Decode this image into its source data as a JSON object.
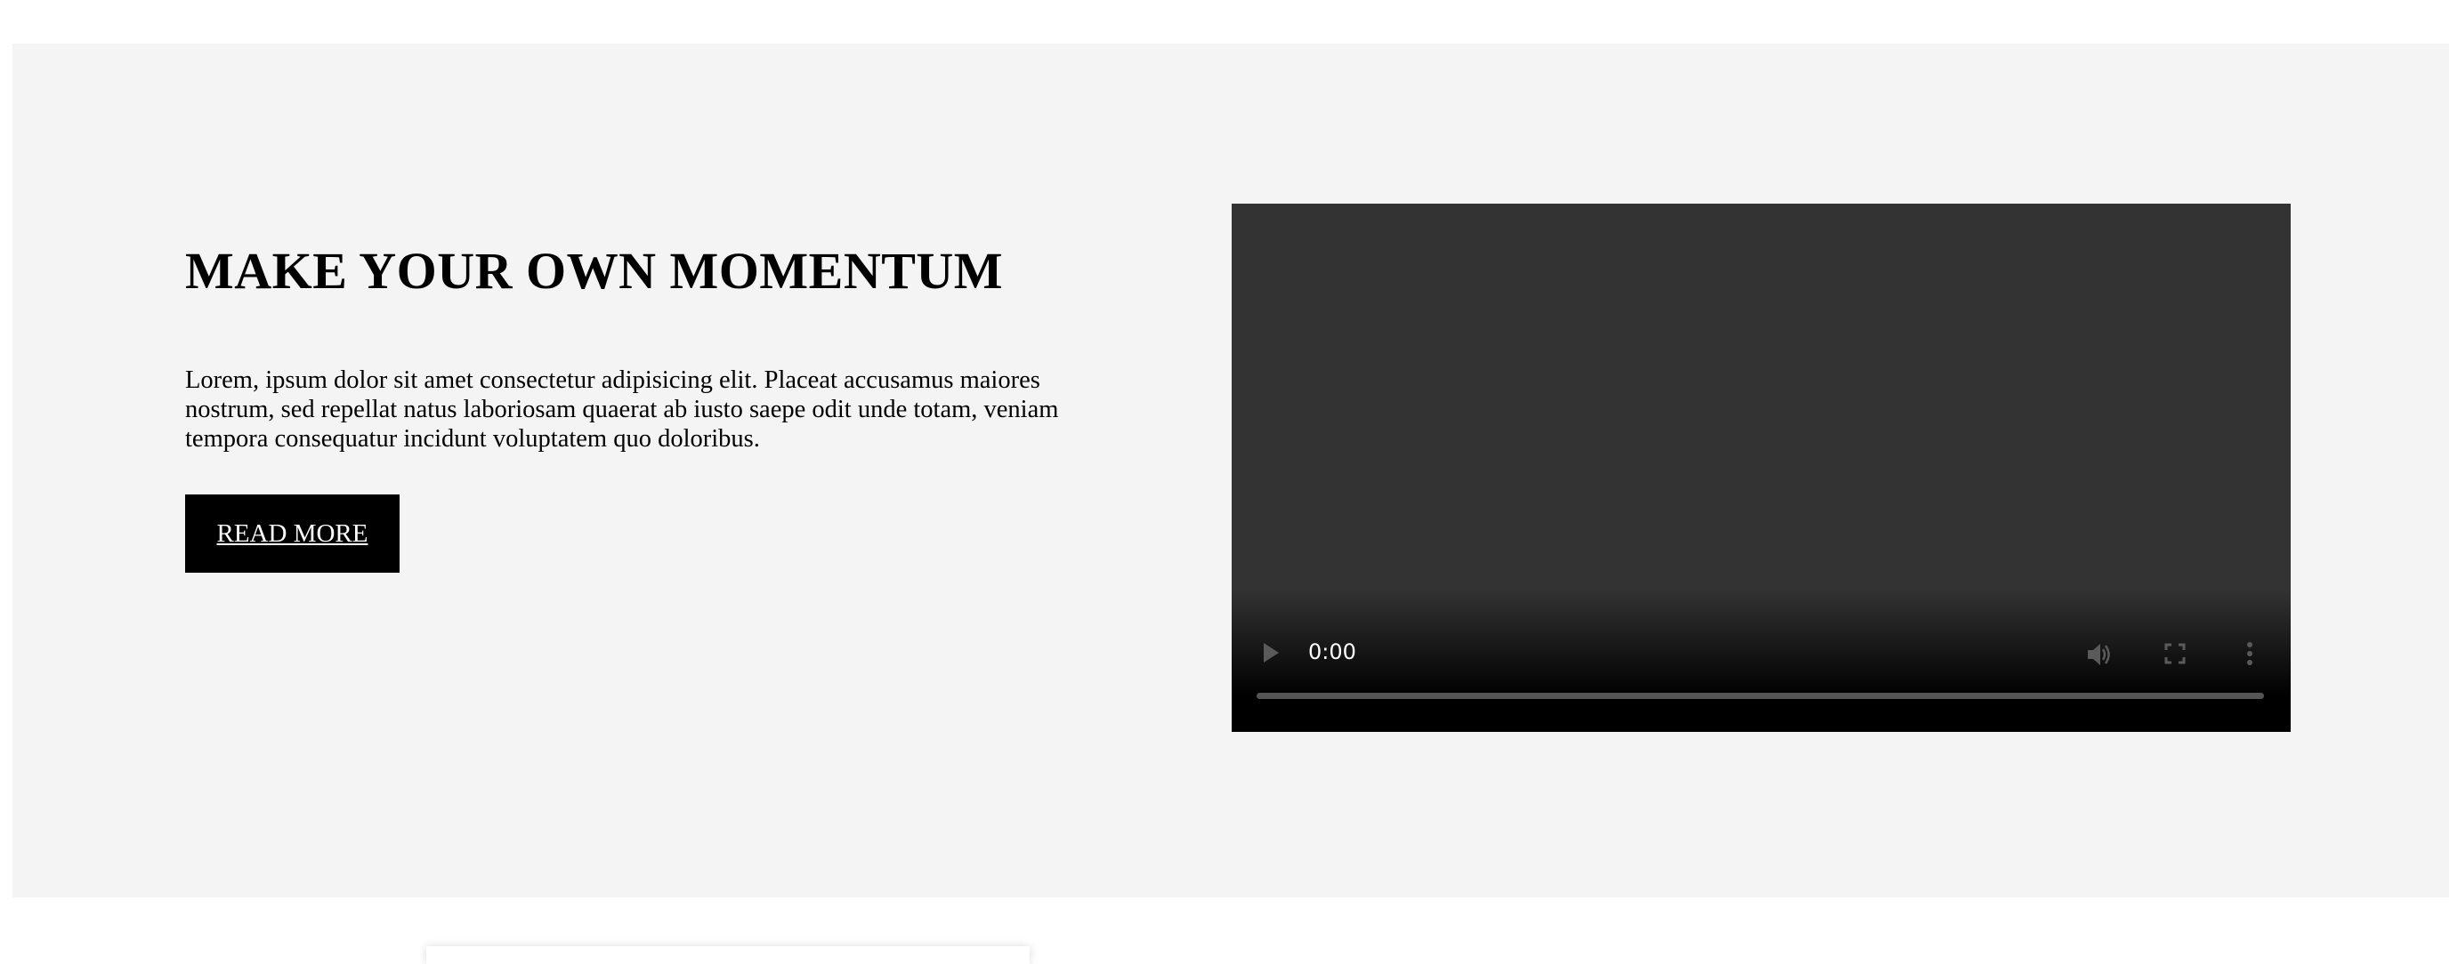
{
  "hero": {
    "title": "MAKE YOUR OWN MOMENTUM",
    "body": "Lorem, ipsum dolor sit amet consectetur adipisicing elit. Placeat accusamus maiores nostrum, sed repellat natus laboriosam quaerat ab iusto saepe odit unde totam, veniam tempora consequatur incidunt voluptatem quo doloribus.",
    "button_label": "READ MORE"
  },
  "video": {
    "time": "0:00",
    "progress": 0,
    "icons": [
      "play-icon",
      "volume-icon",
      "fullscreen-icon",
      "more-options-icon"
    ]
  },
  "colors": {
    "hero_bg": "#f4f4f4",
    "button_bg": "#000000",
    "video_bg": "#333333"
  }
}
